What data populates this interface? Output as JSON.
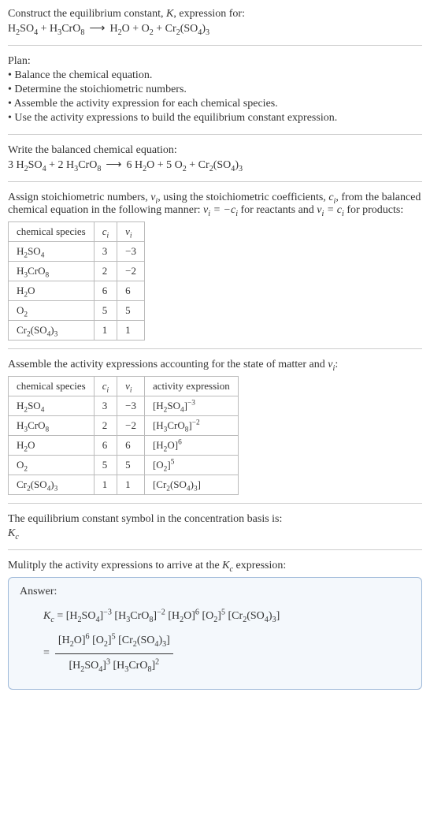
{
  "intro": {
    "line1_a": "Construct the equilibrium constant, ",
    "line1_b": ", expression for:"
  },
  "plan": {
    "heading": "Plan:",
    "b1": "• Balance the chemical equation.",
    "b2": "• Determine the stoichiometric numbers.",
    "b3": "• Assemble the activity expression for each chemical species.",
    "b4": "• Use the activity expressions to build the equilibrium constant expression."
  },
  "balanced": {
    "heading": "Write the balanced chemical equation:"
  },
  "assign": {
    "part1": "Assign stoichiometric numbers, ",
    "part2": ", using the stoichiometric coefficients, ",
    "part3": ", from the balanced chemical equation in the following manner: ",
    "part4": " for reactants and ",
    "part5": " for products:"
  },
  "t1": {
    "h1": "chemical species",
    "r1c2": "3",
    "r1c3": "−3",
    "r2c2": "2",
    "r2c3": "−2",
    "r3c2": "6",
    "r3c3": "6",
    "r4c2": "5",
    "r4c3": "5",
    "r5c2": "1",
    "r5c3": "1"
  },
  "assemble": {
    "text_a": "Assemble the activity expressions accounting for the state of matter and ",
    "text_b": ":"
  },
  "t2": {
    "h1": "chemical species",
    "h4": "activity expression",
    "r1c2": "3",
    "r1c3": "−3",
    "r2c2": "2",
    "r2c3": "−2",
    "r3c2": "6",
    "r3c3": "6",
    "r4c2": "5",
    "r4c3": "5",
    "r5c2": "1",
    "r5c3": "1"
  },
  "symbol_line": "The equilibrium constant symbol in the concentration basis is:",
  "multiply": {
    "part1": "Mulitply the activity expressions to arrive at the ",
    "part2": " expression:"
  },
  "answer": {
    "label": "Answer:"
  },
  "chart_data": {
    "type": "table",
    "tables": [
      {
        "title": "stoichiometric numbers",
        "columns": [
          "chemical species",
          "c_i",
          "ν_i"
        ],
        "rows": [
          [
            "H2SO4",
            3,
            -3
          ],
          [
            "H3CrO8",
            2,
            -2
          ],
          [
            "H2O",
            6,
            6
          ],
          [
            "O2",
            5,
            5
          ],
          [
            "Cr2(SO4)3",
            1,
            1
          ]
        ]
      },
      {
        "title": "activity expressions",
        "columns": [
          "chemical species",
          "c_i",
          "ν_i",
          "activity expression"
        ],
        "rows": [
          [
            "H2SO4",
            3,
            -3,
            "[H2SO4]^-3"
          ],
          [
            "H3CrO8",
            2,
            -2,
            "[H3CrO8]^-2"
          ],
          [
            "H2O",
            6,
            6,
            "[H2O]^6"
          ],
          [
            "O2",
            5,
            5,
            "[O2]^5"
          ],
          [
            "Cr2(SO4)3",
            1,
            1,
            "[Cr2(SO4)3]"
          ]
        ]
      }
    ],
    "unbalanced_equation": "H2SO4 + H3CrO8 -> H2O + O2 + Cr2(SO4)3",
    "balanced_equation": "3 H2SO4 + 2 H3CrO8 -> 6 H2O + 5 O2 + Cr2(SO4)3",
    "equilibrium_constant": "K_c = [H2SO4]^-3 [H3CrO8]^-2 [H2O]^6 [O2]^5 [Cr2(SO4)3] = ([H2O]^6 [O2]^5 [Cr2(SO4)3]) / ([H2SO4]^3 [H3CrO8]^2)"
  }
}
